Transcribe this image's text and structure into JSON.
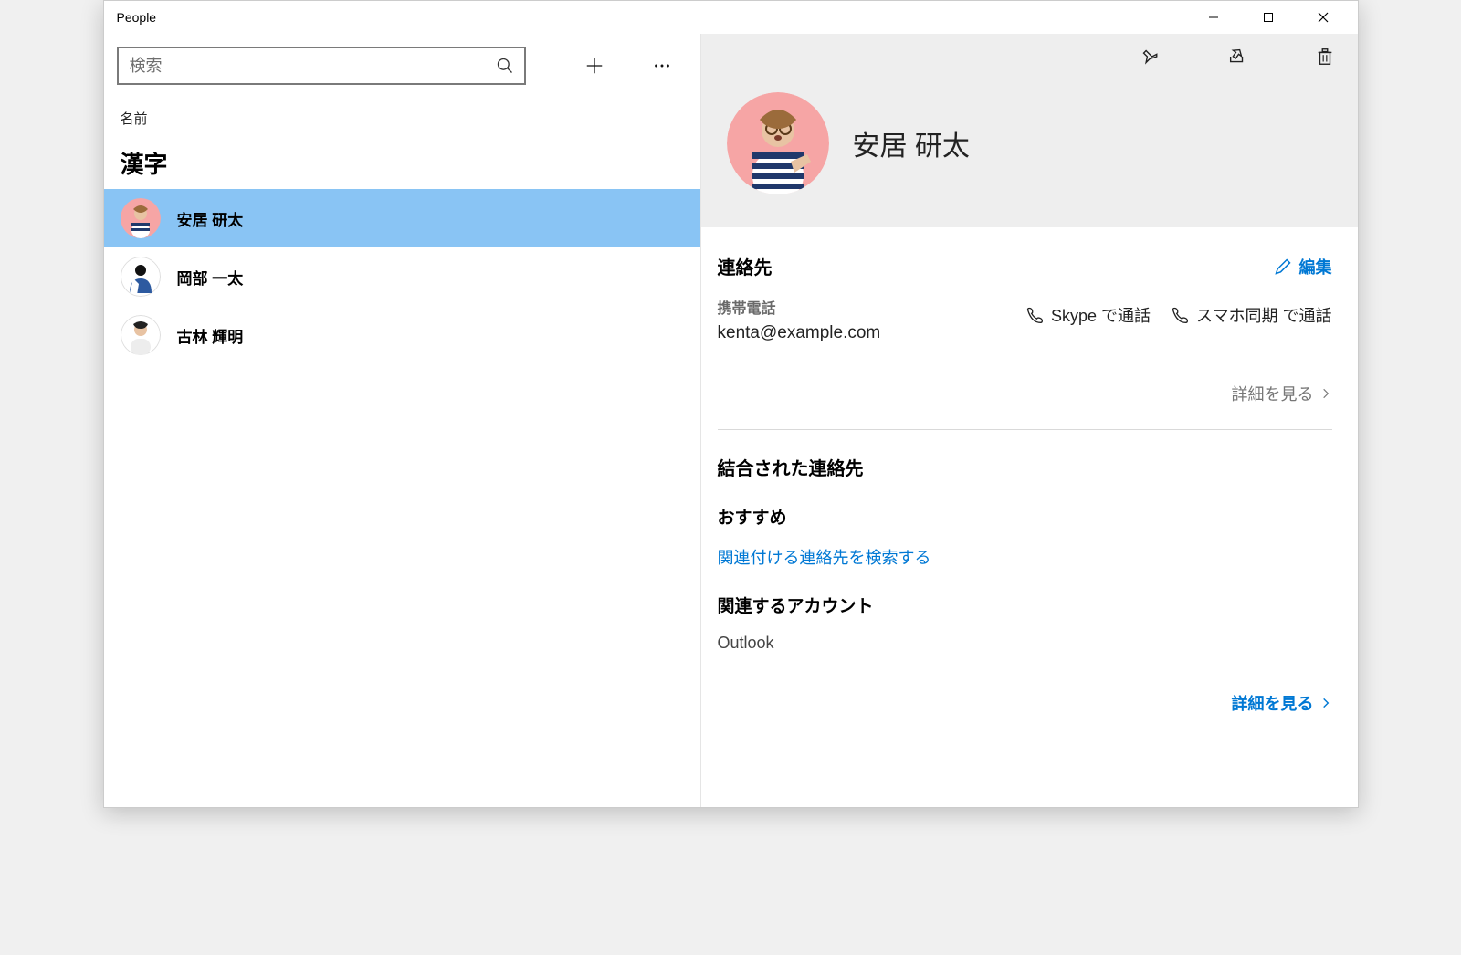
{
  "window": {
    "title": "People"
  },
  "search": {
    "placeholder": "検索"
  },
  "list": {
    "sort_label": "名前",
    "group_header": "漢字",
    "contacts": [
      {
        "name": "安居 研太"
      },
      {
        "name": "岡部 一太"
      },
      {
        "name": "古林 輝明"
      }
    ]
  },
  "detail": {
    "name": "安居 研太",
    "contact_section": "連絡先",
    "edit_label": "編集",
    "phone_label": "携帯電話",
    "email_value": "kenta@example.com",
    "call_skype": "Skype で通話",
    "call_phonelink": "スマホ同期 で通話",
    "show_more": "詳細を見る",
    "linked_section": "結合された連絡先",
    "suggested_header": "おすすめ",
    "find_linked": "関連付ける連絡先を検索する",
    "related_accounts_header": "関連するアカウント",
    "account": "Outlook"
  }
}
